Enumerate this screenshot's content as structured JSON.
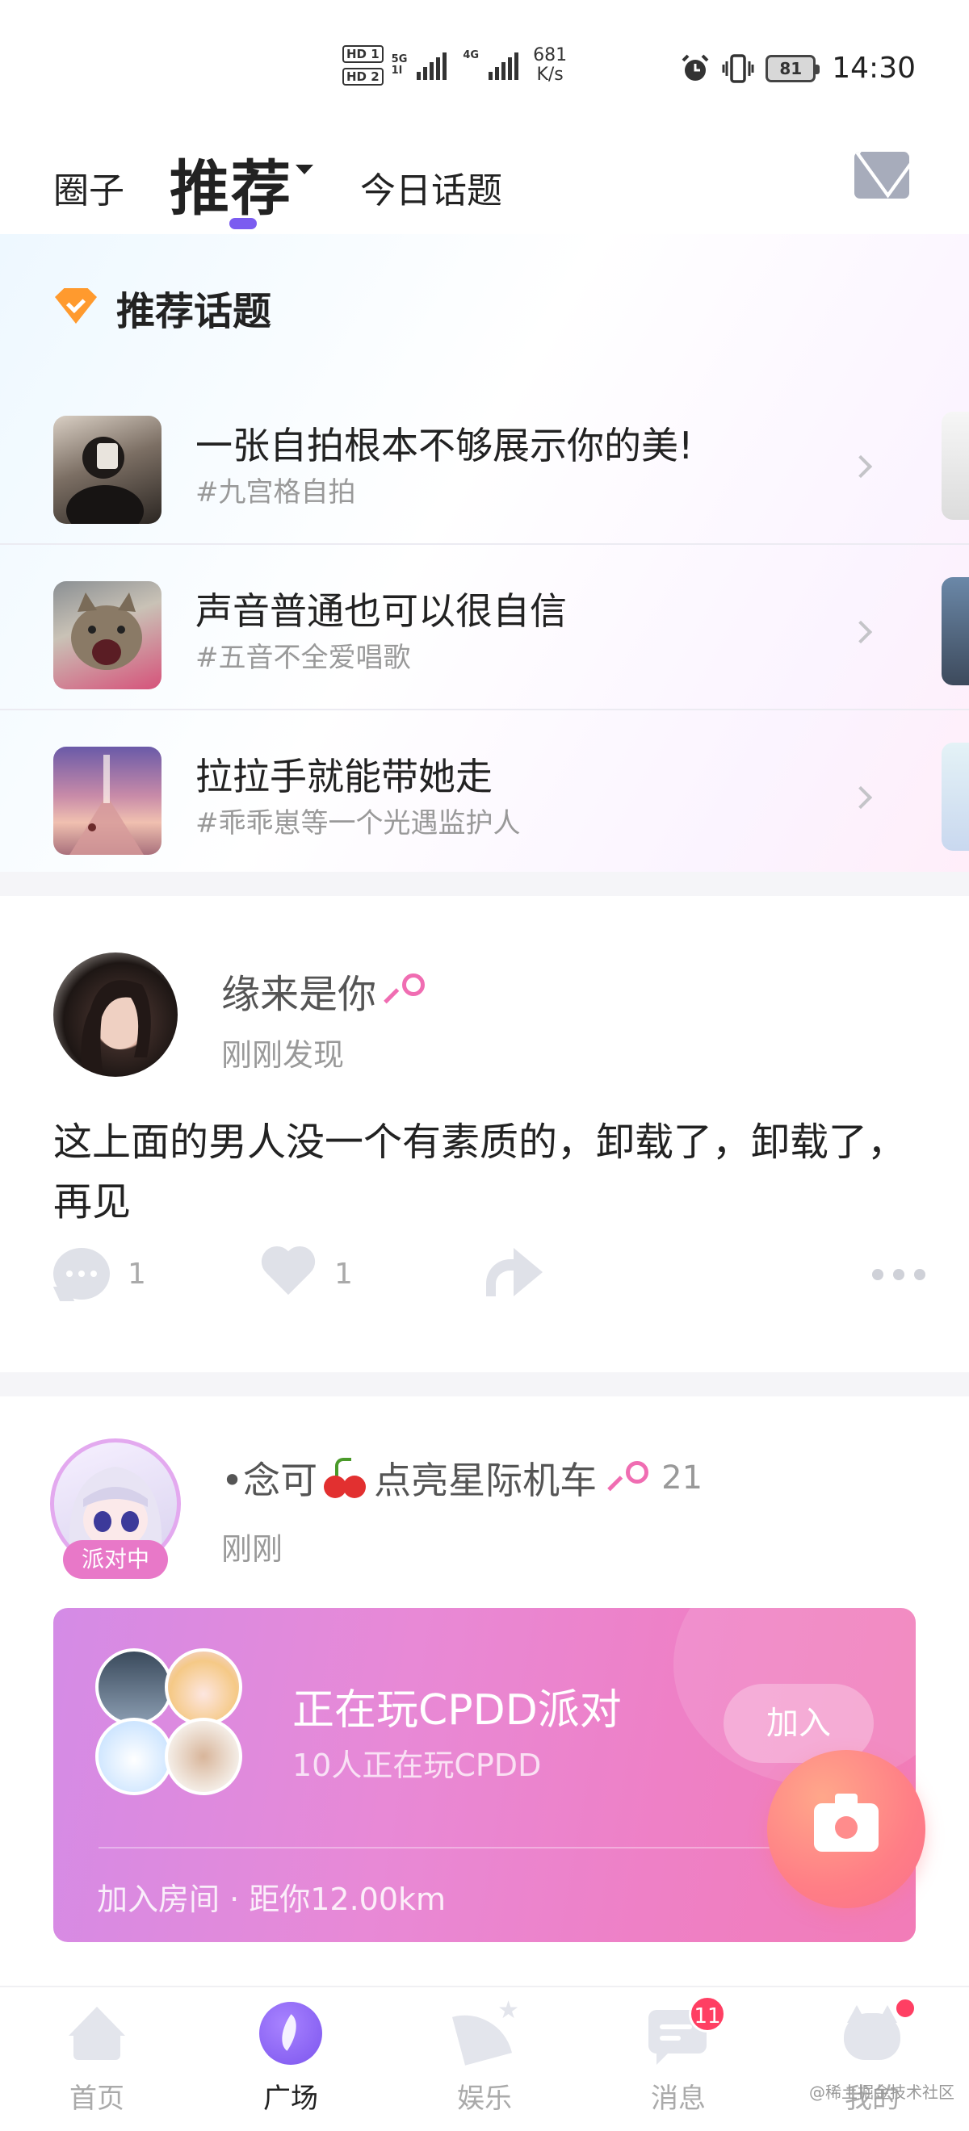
{
  "status_bar": {
    "hd1": "HD 1",
    "hd2": "HD 2",
    "sig1_tag_top": "5G",
    "sig1_tag_bottom": "1l",
    "sig2_tag": "4G",
    "speed_value": "681",
    "speed_unit": "K/s",
    "battery": "81",
    "time": "14:30"
  },
  "header": {
    "tabs": [
      {
        "label": "圈子",
        "active": false
      },
      {
        "label": "推荐",
        "active": true
      },
      {
        "label": "今日话题",
        "active": false
      }
    ],
    "mail_icon": "envelope-icon",
    "accent_color": "#7b5cf0"
  },
  "recommended_topics": {
    "title": "推荐话题",
    "icon": "crown-badge-icon",
    "items": [
      {
        "title": "一张自拍根本不够展示你的美!",
        "tag": "#九宫格自拍"
      },
      {
        "title": "声音普通也可以很自信",
        "tag": "#五音不全爱唱歌"
      },
      {
        "title": "拉拉手就能带她走",
        "tag": "#乖乖崽等一个光遇监护人"
      }
    ]
  },
  "post": {
    "username": "缘来是你",
    "gender_icon": "female-icon",
    "time": "刚刚发现",
    "content": "这上面的男人没一个有素质的，卸载了，卸载了，再见",
    "comments": "1",
    "likes": "1"
  },
  "party_post": {
    "username_prefix": "•念可",
    "username_emoji_icon": "cherry-icon",
    "username_suffix": "点亮星际机车",
    "gender_icon": "female-icon",
    "level": "21",
    "time": "刚刚",
    "badge": "派对中",
    "card": {
      "title": "正在玩CPDD派对",
      "subtitle": "10人正在玩CPDD",
      "join_label": "加入",
      "footer": "加入房间 · 距你12.00km"
    }
  },
  "fab": {
    "icon": "camera-icon"
  },
  "bottom_nav": {
    "items": [
      {
        "label": "首页",
        "icon": "home-icon"
      },
      {
        "label": "广场",
        "icon": "plaza-icon",
        "active": true
      },
      {
        "label": "娱乐",
        "icon": "entertainment-icon"
      },
      {
        "label": "消息",
        "icon": "message-icon",
        "badge": "11"
      },
      {
        "label": "我的",
        "icon": "profile-icon"
      }
    ]
  },
  "watermark": "@稀土掘金技术社区"
}
